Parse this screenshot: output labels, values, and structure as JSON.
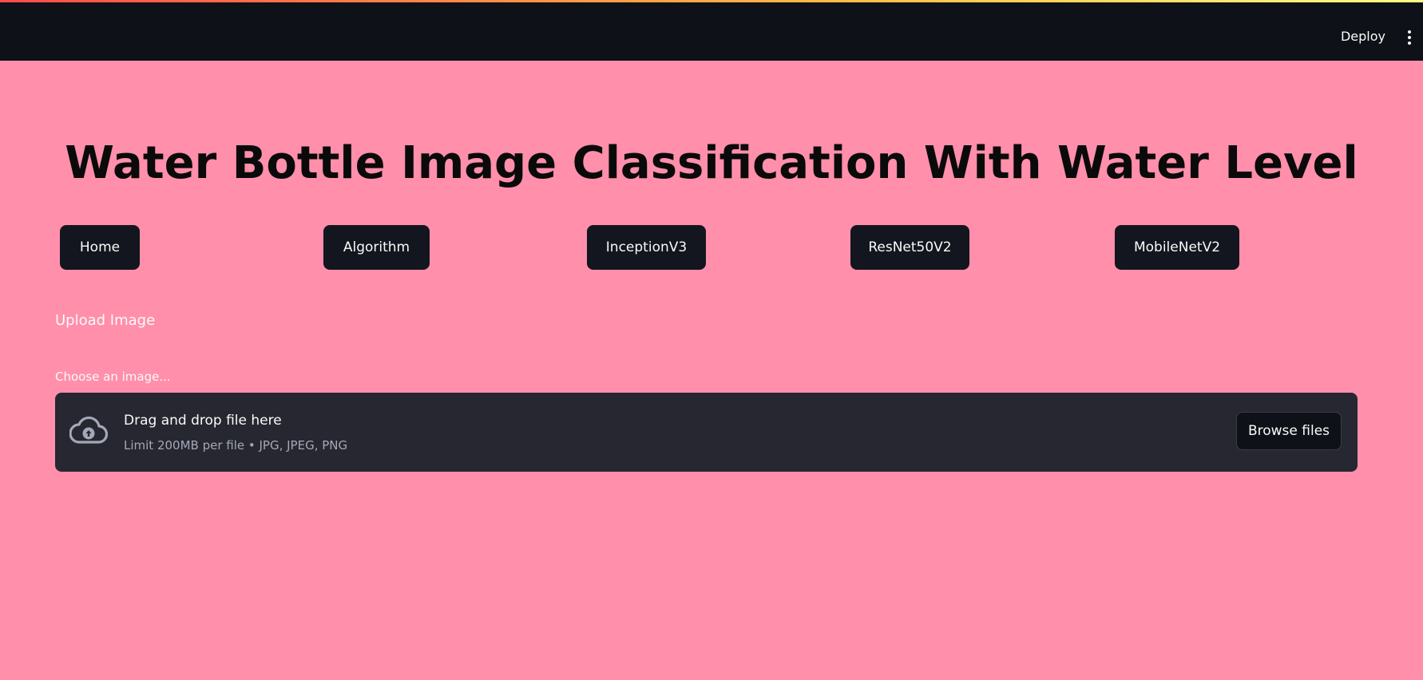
{
  "header": {
    "deploy_label": "Deploy",
    "menu_icon": "kebab-menu-icon"
  },
  "main": {
    "title": "Water Bottle Image Classification With Water Level",
    "nav_buttons": [
      {
        "label": "Home"
      },
      {
        "label": "Algorithm"
      },
      {
        "label": "InceptionV3"
      },
      {
        "label": "ResNet50V2"
      },
      {
        "label": "MobileNetV2"
      }
    ],
    "upload_heading": "Upload Image",
    "uploader": {
      "label": "Choose an image...",
      "icon": "cloud-upload-icon",
      "drop_title": "Drag and drop file here",
      "drop_limit": "Limit 200MB per file • JPG, JPEG, PNG",
      "browse_label": "Browse files"
    }
  },
  "colors": {
    "background": "#ff8fab",
    "header": "#0e1117",
    "button": "#13161e",
    "dropzone": "#262730",
    "text_light": "#fafafa",
    "text_muted": "#a3a8b8"
  }
}
